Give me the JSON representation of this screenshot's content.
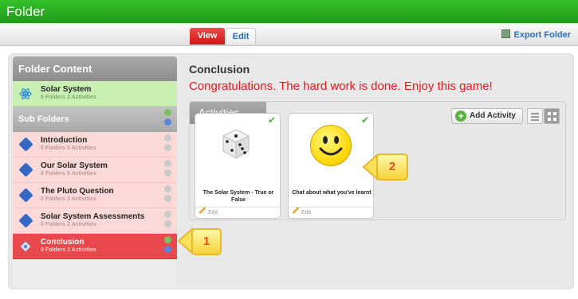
{
  "window": {
    "title": "Folder"
  },
  "toolbar": {
    "view_tab": "View",
    "edit_tab": "Edit",
    "export_label": "Export Folder"
  },
  "sidebar": {
    "header": "Folder Content",
    "root": {
      "title": "Solar System",
      "meta": "5 Folders 2 Activities"
    },
    "sub_folders_label": "Sub Folders",
    "items": [
      {
        "title": "Introduction",
        "meta": "0 Folders 5 Activities"
      },
      {
        "title": "Our Solar System",
        "meta": "0 Folders 5 Activities"
      },
      {
        "title": "The Pluto Question",
        "meta": "0 Folders 3 Activities"
      },
      {
        "title": "Solar System Assessments",
        "meta": "0 Folders 2 Activities"
      },
      {
        "title": "Conclusion",
        "meta": "0 Folders 2 Activities"
      }
    ]
  },
  "main": {
    "title": "Conclusion",
    "message": "Congratulations. The hard work is done. Enjoy this game!",
    "activities": {
      "tab_label": "Activities",
      "add_label": "Add Activity",
      "cards": [
        {
          "title": "The Solar System - True or False",
          "edit": "Edit",
          "icon": "dice-icon"
        },
        {
          "title": "Chat about what you've learnt",
          "edit": "Edit",
          "icon": "smiley-icon"
        }
      ]
    }
  },
  "callouts": [
    "1",
    "2"
  ],
  "colors": {
    "titlebar": "#1f9a1a",
    "accent_red": "#e31b1b",
    "selected_row": "#e9484c",
    "callout": "#f5d33a"
  }
}
